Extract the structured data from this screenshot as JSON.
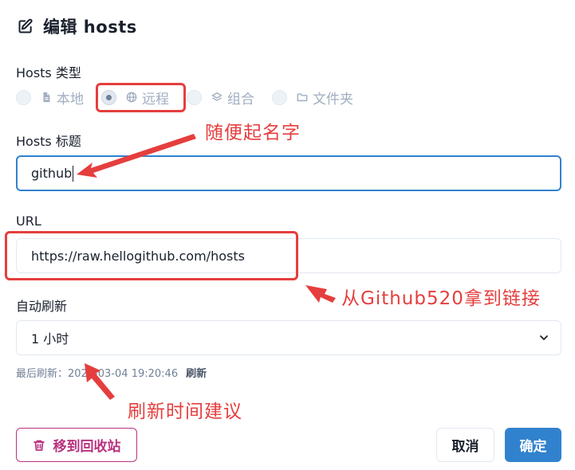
{
  "dialog": {
    "title": "编辑 hosts"
  },
  "hosts_type": {
    "label": "Hosts 类型",
    "options": [
      {
        "label": "本地",
        "icon": "file-icon",
        "checked": false
      },
      {
        "label": "远程",
        "icon": "globe-icon",
        "checked": true
      },
      {
        "label": "组合",
        "icon": "layers-icon",
        "checked": false
      },
      {
        "label": "文件夹",
        "icon": "folder-icon",
        "checked": false
      }
    ]
  },
  "hosts_title": {
    "label": "Hosts 标题",
    "value": "github"
  },
  "url": {
    "label": "URL",
    "value": "https://raw.hellogithub.com/hosts"
  },
  "auto_refresh": {
    "label": "自动刷新",
    "selected": "1 小时",
    "last_refresh_label": "最后刷新：",
    "last_refresh_time": "2023-03-04 19:20:46",
    "refresh_link": "刷新"
  },
  "annotations": {
    "title_note": "随便起名字",
    "url_note": "从Github520拿到链接",
    "refresh_note": "刷新时间建议"
  },
  "buttons": {
    "move_to_trash": "移到回收站",
    "cancel": "取消",
    "confirm": "确定"
  },
  "colors": {
    "accent": "#3182ce",
    "annotation": "#e53e3e",
    "danger": "#b83280"
  }
}
